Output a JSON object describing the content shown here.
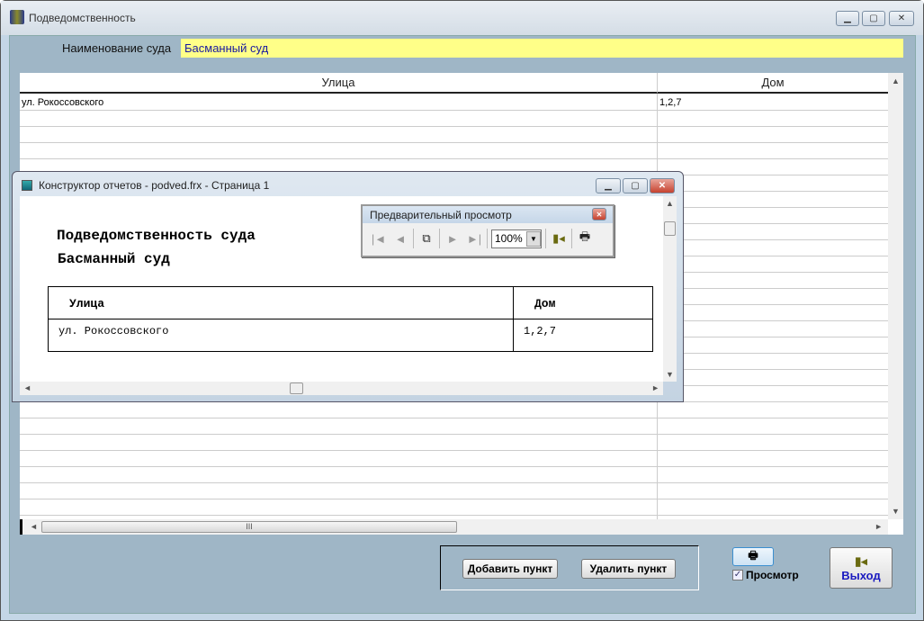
{
  "window": {
    "title": "Подведомственность"
  },
  "form": {
    "court_label": "Наименование суда",
    "court_value": "Басманный суд"
  },
  "grid": {
    "columns": [
      "Улица",
      "Дом"
    ],
    "rows": [
      {
        "street": "ул. Рокоссовского",
        "house": "1,2,7"
      }
    ]
  },
  "report": {
    "title": "Конструктор отчетов - podved.frx - Страница 1",
    "heading": "Подведомственность суда",
    "subheading": "Басманный суд",
    "columns": [
      "Улица",
      "Дом"
    ],
    "rows": [
      {
        "street": "ул. Рокоссовского",
        "house": "1,2,7"
      }
    ]
  },
  "preview_toolbar": {
    "title": "Предварительный просмотр",
    "zoom": "100%"
  },
  "buttons": {
    "add": "Добавить пункт",
    "delete": "Удалить пункт",
    "preview_label": "Просмотр",
    "preview_checked": true,
    "exit": "Выход"
  }
}
